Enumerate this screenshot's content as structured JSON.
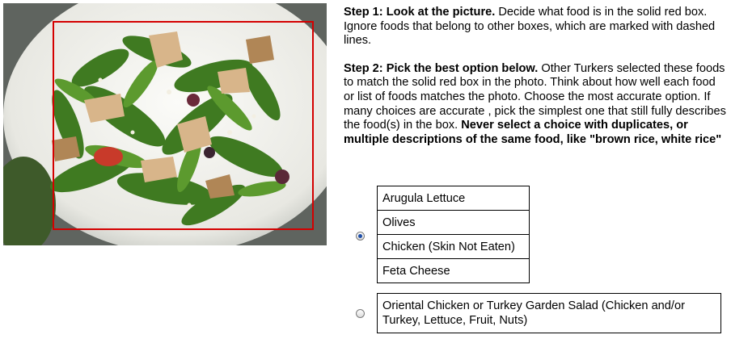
{
  "instructions": {
    "step1_bold": "Step 1: Look at the picture.",
    "step1_text": " Decide what food is in the solid red box. Ignore foods that belong to other boxes, which are marked with dashed lines.",
    "step2_bold": "Step 2: Pick the best option below.",
    "step2_text": " Other Turkers selected these foods to match the solid red box in the photo. Think about how well each food or list of foods matches the photo. Choose the most accurate option. If many choices are accurate , pick the simplest one that still fully describes the food(s) in the box. ",
    "step2_warning": "Never select a choice with duplicates, or multiple descriptions of the same food, like \"brown rice, white rice\""
  },
  "options": [
    {
      "selected": true,
      "items": [
        "Arugula Lettuce",
        "Olives",
        "Chicken (Skin Not Eaten)",
        "Feta Cheese"
      ]
    },
    {
      "selected": false,
      "text": "Oriental Chicken or Turkey Garden Salad (Chicken and/or Turkey, Lettuce, Fruit, Nuts)"
    }
  ],
  "colors": {
    "red_box": "#d40000",
    "radio_dot": "#1f4fa8"
  }
}
